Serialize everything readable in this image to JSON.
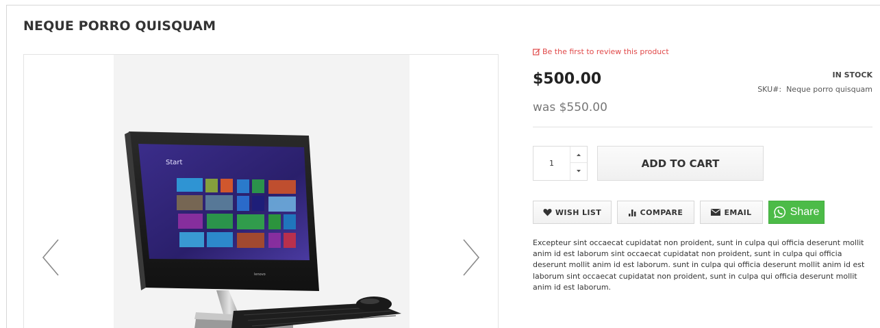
{
  "product": {
    "title": "NEQUE PORRO QUISQUAM",
    "review_link": "Be the first to review this product",
    "price": "$500.00",
    "old_price": "was $550.00",
    "stock_status": "IN STOCK",
    "sku_label": "SKU#:",
    "sku_value": "Neque porro quisquam",
    "description": "Excepteur sint occaecat cupidatat non proident, sunt in culpa qui officia deserunt mollit anim id est laborum sint occaecat cupidatat non proident, sunt in culpa qui officia deserunt mollit anim id est laborum. sunt in culpa qui officia deserunt mollit anim id est laborum sint occaecat cupidatat non proident, sunt in culpa qui officia deserunt mollit anim id est laborum."
  },
  "gallery": {
    "screen_start_text": "Start",
    "brand_text": "lenovo",
    "prev_icon": "chevron-left-icon",
    "next_icon": "chevron-right-icon"
  },
  "cart": {
    "quantity": "1",
    "add_label": "ADD TO CART"
  },
  "actions": {
    "wishlist_label": "WISH LIST",
    "compare_label": "COMPARE",
    "email_label": "EMAIL",
    "share_label": "Share"
  },
  "colors": {
    "review_link": "#e04848",
    "share_button": "#4cbb48"
  }
}
